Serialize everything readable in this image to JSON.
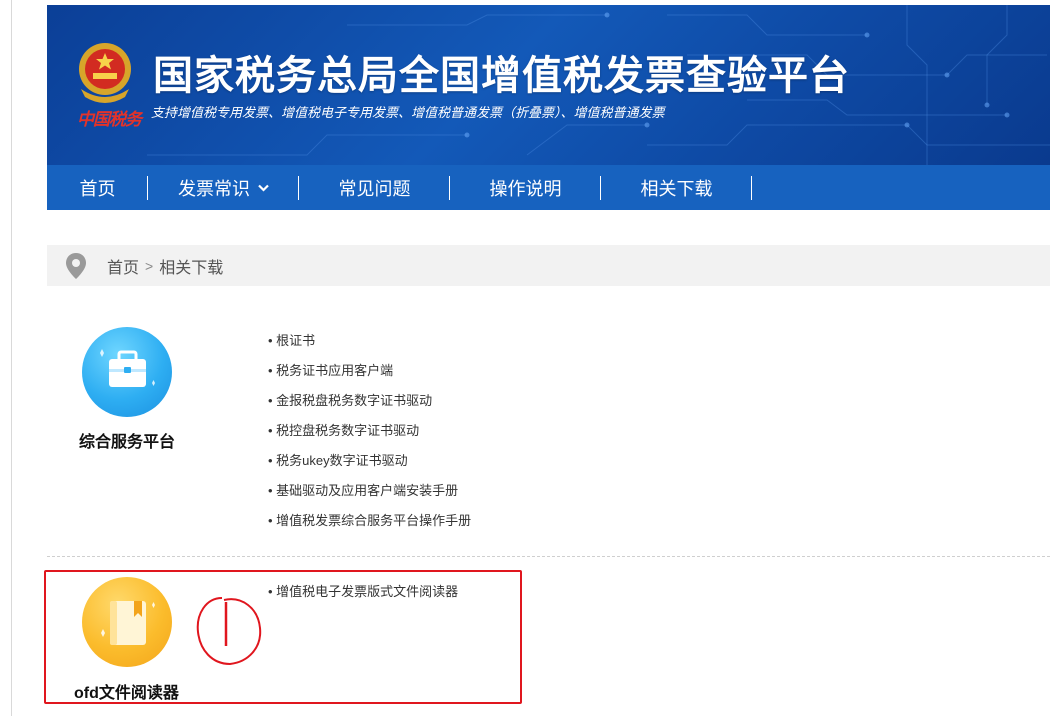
{
  "header": {
    "title": "国家税务总局全国增值税发票查验平台",
    "subtitle": "支持增值税专用发票、增值税电子专用发票、增值税普通发票（折叠票）、增值税普通发票",
    "seal_text": "中国税务"
  },
  "nav": {
    "items": [
      {
        "label": "首页"
      },
      {
        "label": "发票常识"
      },
      {
        "label": "常见问题"
      },
      {
        "label": "操作说明"
      },
      {
        "label": "相关下载"
      }
    ]
  },
  "breadcrumb": {
    "home": "首页",
    "separator": ">",
    "current": "相关下载"
  },
  "sections": [
    {
      "title": "综合服务平台",
      "icon": "briefcase-icon",
      "color": "#2eaef2",
      "links": [
        "根证书",
        "税务证书应用客户端",
        "金报税盘税务数字证书驱动",
        "税控盘税务数字证书驱动",
        "税务ukey数字证书驱动",
        "基础驱动及应用客户端安装手册",
        "增值税发票综合服务平台操作手册"
      ]
    },
    {
      "title": "ofd文件阅读器",
      "icon": "book-icon",
      "color": "#fbbc2c",
      "links": [
        "增值税电子发票版式文件阅读器"
      ]
    }
  ],
  "colors": {
    "nav_bg": "#1762bf",
    "banner_bg": "#0e4aa5",
    "highlight": "#e0161e"
  }
}
